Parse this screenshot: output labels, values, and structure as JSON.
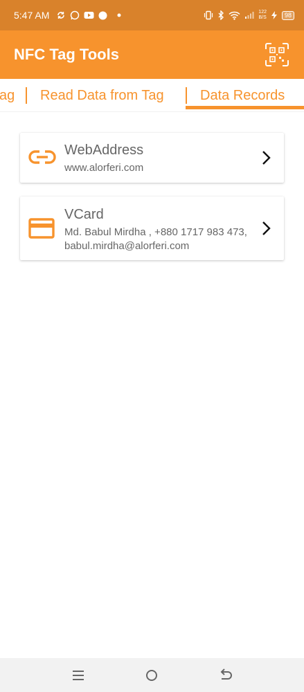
{
  "status_bar": {
    "time": "5:47 AM",
    "net_speed_top": "122",
    "net_speed_bottom": "B/S",
    "battery": "98",
    "left_icons": [
      "sync-icon",
      "whatsapp-icon",
      "youtube-icon",
      "circle-icon",
      "dot-icon"
    ],
    "right_icons": [
      "vibrate-icon",
      "bluetooth-icon",
      "wifi-icon",
      "signal-icon",
      "charging-icon"
    ]
  },
  "app_bar": {
    "title": "NFC Tag Tools",
    "qr_icon": "qr-scan-icon"
  },
  "tabs": [
    {
      "label": "ag"
    },
    {
      "label": "Read Data from Tag"
    },
    {
      "label": "Data Records",
      "selected": true
    }
  ],
  "records": [
    {
      "title": "WebAddress",
      "subtitle": "www.alorferi.com",
      "icon": "link-icon"
    },
    {
      "title": "VCard",
      "subtitle": "Md. Babul Mirdha , +880 1717 983 473, babul.mirdha@alorferi.com",
      "icon": "card-icon"
    }
  ],
  "nav_bar": {
    "icons": [
      "menu-icon",
      "home-icon",
      "back-icon"
    ]
  },
  "colors": {
    "status_bar": "#d9822b",
    "accent": "#f7932d",
    "text_secondary": "#666666",
    "nav_bar": "#f2f2f2"
  }
}
